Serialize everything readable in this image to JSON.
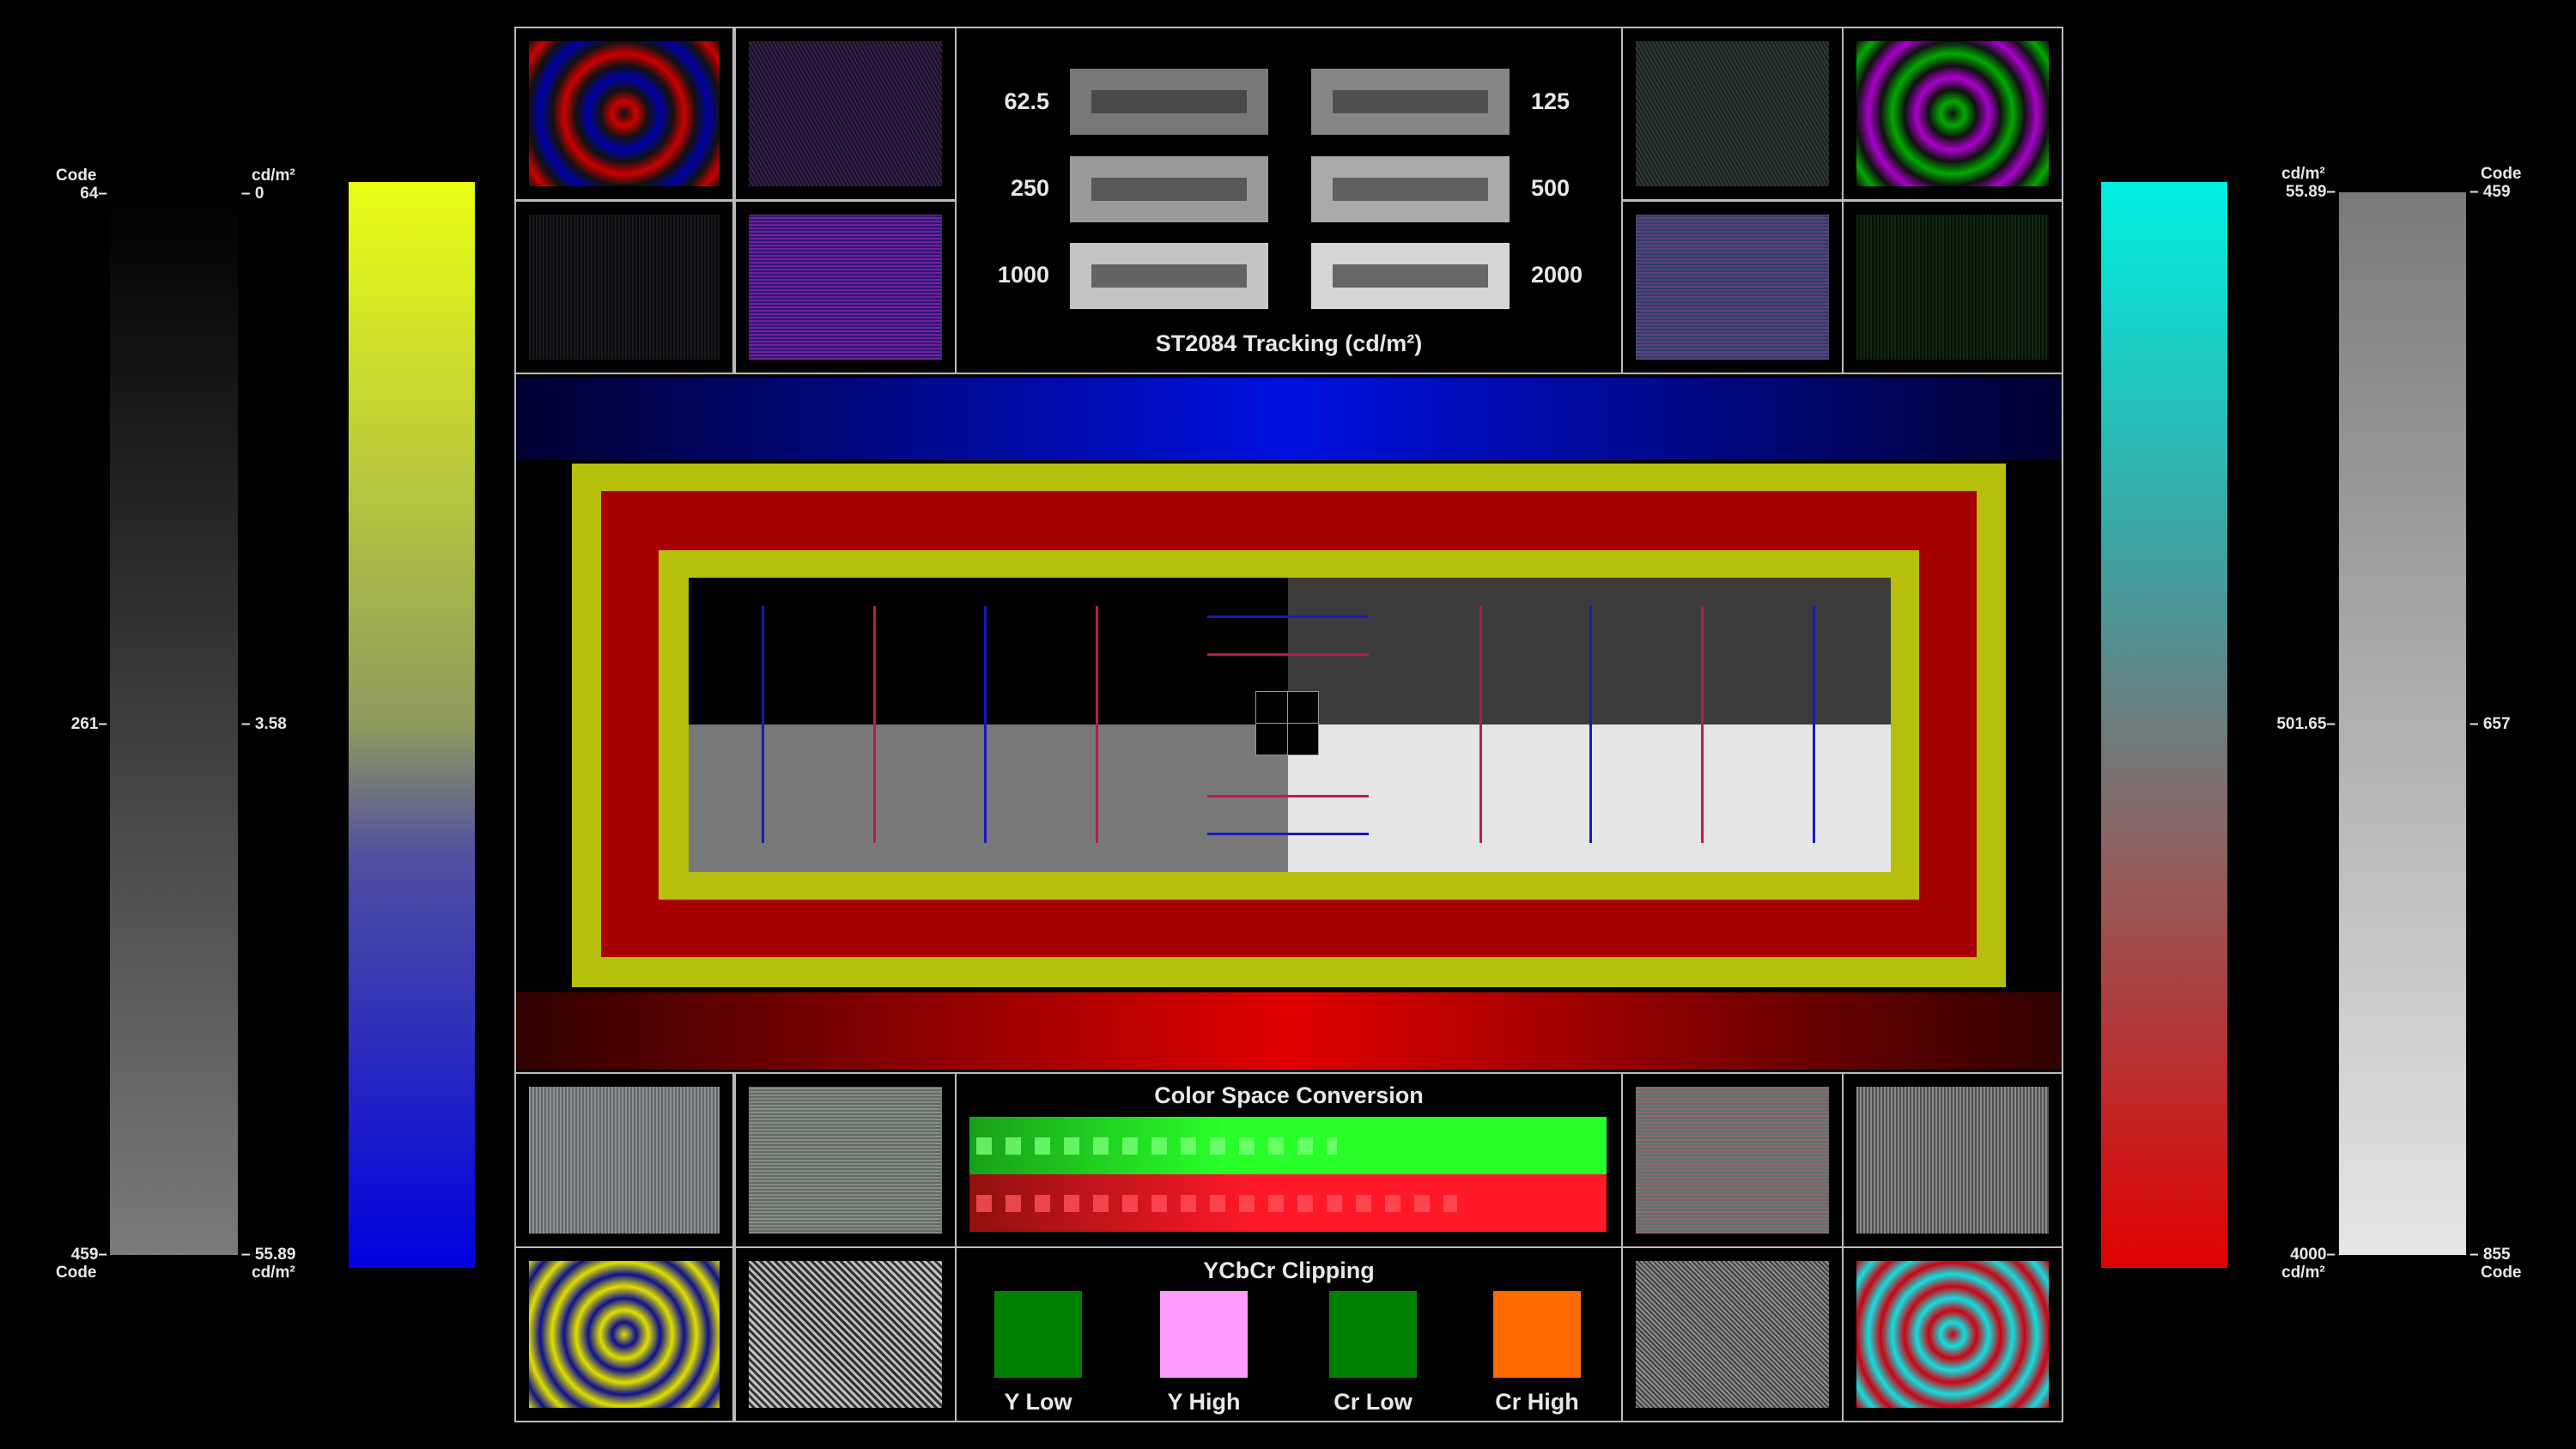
{
  "left_scale": {
    "code_header": "Code",
    "cd_header": "cd/m²",
    "code_ticks": [
      "64–",
      "261–",
      "459–"
    ],
    "cd_ticks": [
      "– 0",
      "– 3.58",
      "– 55.89"
    ],
    "code_footer": "Code",
    "cd_footer": "cd/m²"
  },
  "right_scale": {
    "cd_header": "cd/m²",
    "code_header": "Code",
    "cd_ticks": [
      "55.89–",
      "501.65–",
      "4000–"
    ],
    "code_ticks": [
      "– 459",
      "– 657",
      "– 855"
    ],
    "cd_footer": "cd/m²",
    "code_footer": "Code"
  },
  "tracking": {
    "title": "ST2084 Tracking (cd/m²)",
    "left_labels": [
      "62.5",
      "250",
      "1000"
    ],
    "right_labels": [
      "125",
      "500",
      "2000"
    ]
  },
  "color_space": {
    "title": "Color Space Conversion"
  },
  "clipping": {
    "title": "YCbCr Clipping",
    "items": [
      {
        "label": "Y Low",
        "color": "#008000"
      },
      {
        "label": "Y High",
        "color": "#ff9cff"
      },
      {
        "label": "Cr Low",
        "color": "#008000"
      },
      {
        "label": "Cr High",
        "color": "#ff6a00"
      }
    ]
  },
  "colors": {
    "yellow": "#b5bf0c",
    "red": "#a80000",
    "blue_band": "#0010e0",
    "red_band": "#e00000"
  }
}
